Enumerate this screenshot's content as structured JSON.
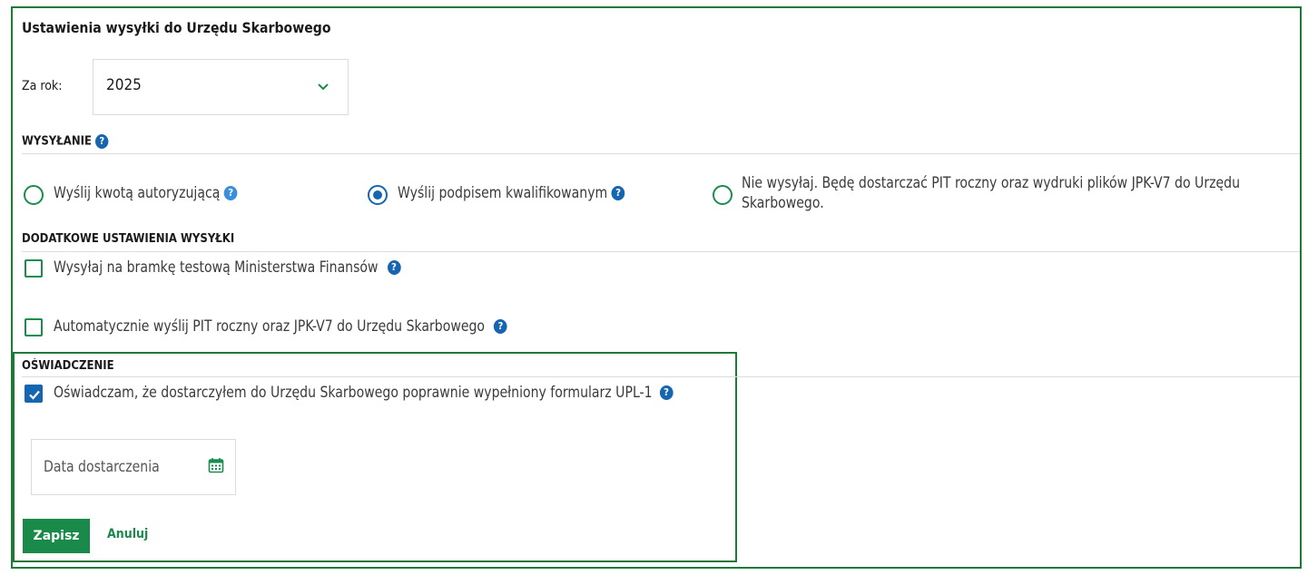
{
  "title": "Ustawienia wysyłki do Urzędu Skarbowego",
  "year": {
    "label": "Za rok:",
    "selected": "2025"
  },
  "sending": {
    "heading": "WYSYŁANIE",
    "options": [
      {
        "label": "Wyślij kwotą autoryzującą",
        "checked": false
      },
      {
        "label": "Wyślij podpisem kwalifikowanym",
        "checked": true
      },
      {
        "label_line1": "Nie wysyłaj. Będę dostarczać PIT roczny oraz wydruki plików JPK-V7 do Urzędu",
        "label_line2": "Skarbowego.",
        "checked": false
      }
    ]
  },
  "additional": {
    "heading": "DODATKOWE USTAWIENIA WYSYŁKI",
    "options": [
      {
        "label": "Wysyłaj na bramkę testową Ministerstwa Finansów",
        "checked": false
      },
      {
        "label": "Automatycznie wyślij PIT roczny oraz JPK-V7 do Urzędu Skarbowego",
        "checked": false
      }
    ]
  },
  "declaration": {
    "heading": "OŚWIADCZENIE",
    "statement": "Oświadczam, że dostarczyłem do Urzędu Skarbowego poprawnie wypełniony formularz UPL-1",
    "checked": true,
    "date_placeholder": "Data dostarczenia"
  },
  "actions": {
    "save": "Zapisz",
    "cancel": "Anuluj"
  },
  "help_glyph": "?",
  "colors": {
    "accent_green": "#1a8a4a",
    "info_blue": "#1565b0",
    "border_green": "#1f7a3a"
  }
}
